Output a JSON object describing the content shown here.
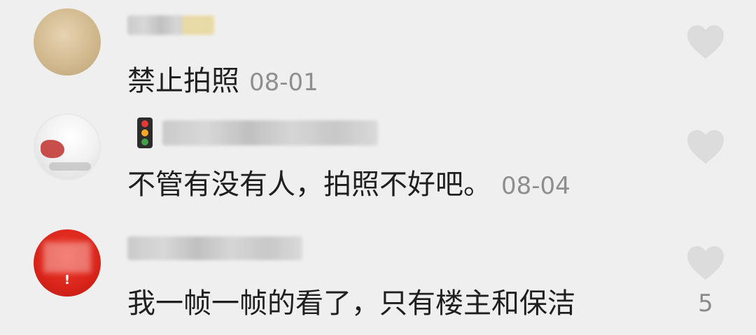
{
  "comments": [
    {
      "text": "禁止拍照",
      "date": "08-01",
      "like_icon": "heart-icon"
    },
    {
      "text": "不管有没有人，拍照不好吧。",
      "date": "08-04",
      "like_icon": "heart-icon",
      "badge_icon": "traffic-light-icon"
    },
    {
      "text": "我一帧一帧的看了，只有楼主和保洁",
      "like_count": "5",
      "like_icon": "heart-icon"
    }
  ],
  "colors": {
    "background": "#efefef",
    "text": "#1f1f1f",
    "meta": "#8e8e8e",
    "heart": "#dcdcdc"
  }
}
